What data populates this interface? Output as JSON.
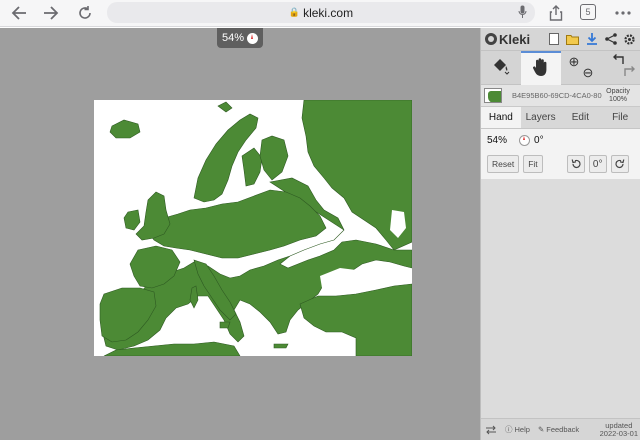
{
  "browser": {
    "url": "kleki.com",
    "tab_count": "5"
  },
  "canvas": {
    "zoom_label": "54%",
    "fill_color": "#4c8a35"
  },
  "panel": {
    "app_name": "Kleki",
    "layer": {
      "name": "B4E95B60-69CD-4CA0-80",
      "opacity_label": "Opacity",
      "opacity_value": "100%"
    },
    "tabs": [
      {
        "label": "Hand",
        "active": true
      },
      {
        "label": "Layers",
        "active": false
      },
      {
        "label": "Edit",
        "active": false
      },
      {
        "label": "File",
        "active": false
      }
    ],
    "hand": {
      "zoom": "54%",
      "rotation": "0°",
      "reset_label": "Reset",
      "fit_label": "Fit",
      "angle_btn_label": "0°"
    },
    "footer": {
      "help_label": "Help",
      "feedback_label": "Feedback",
      "updated_label": "updated",
      "updated_date": "2022-03-01"
    }
  }
}
